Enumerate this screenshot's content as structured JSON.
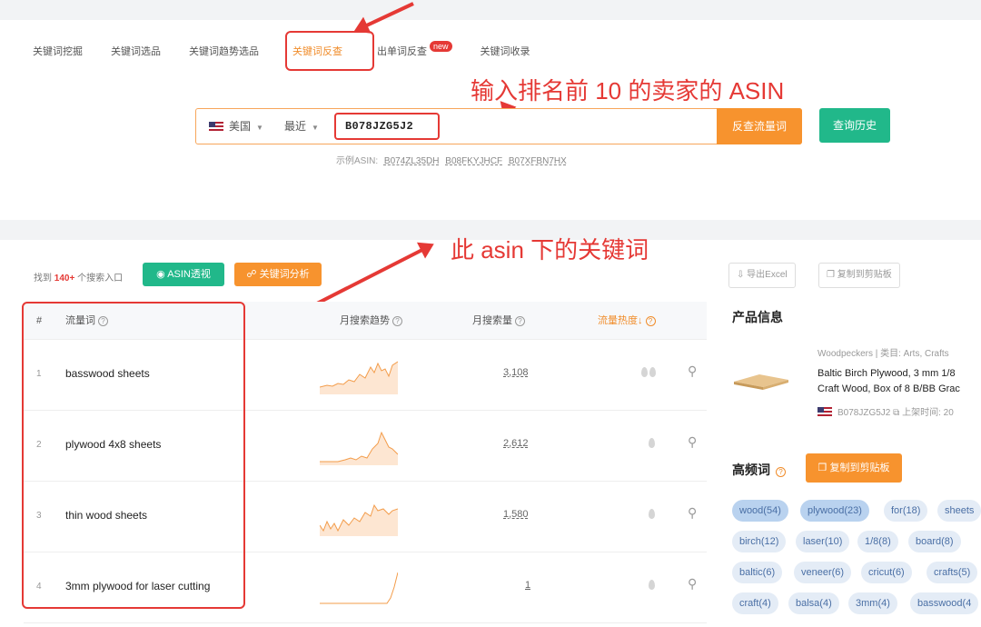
{
  "tabs": [
    {
      "label": "关键词挖掘"
    },
    {
      "label": "关键词选品"
    },
    {
      "label": "关键词趋势选品"
    },
    {
      "label": "关键词反查"
    },
    {
      "label": "出单词反查",
      "badge": "new"
    },
    {
      "label": "关键词收录"
    }
  ],
  "search": {
    "country": "美国",
    "period": "最近",
    "asin_value": "B078JZG5J2",
    "reverse_button": "反查流量词",
    "history_button": "查询历史",
    "examples_label": "示例ASIN:",
    "examples": [
      "B074ZL35DH",
      "B08FKYJHCF",
      "B07XFBN7HX"
    ]
  },
  "annotations": {
    "input_hint": "输入排名前 10 的卖家的 ASIN",
    "keywords_hint": "此 asin 下的关键词"
  },
  "results": {
    "found_prefix": "找到",
    "found_count": "140+",
    "found_suffix": "个搜索入口",
    "asin_button": "ASIN透视",
    "kw_button": "关键词分析"
  },
  "table": {
    "headers": {
      "idx": "#",
      "keyword": "流量词",
      "trend": "月搜索趋势",
      "volume": "月搜索量",
      "heat": "流量热度↓"
    },
    "rows": [
      {
        "idx": "1",
        "keyword": "basswood sheets",
        "volume": "3,108",
        "drops": 2
      },
      {
        "idx": "2",
        "keyword": "plywood 4x8 sheets",
        "volume": "2,612",
        "drops": 1
      },
      {
        "idx": "3",
        "keyword": "thin wood sheets",
        "volume": "1,580",
        "drops": 1
      },
      {
        "idx": "4",
        "keyword": "3mm plywood for laser cutting",
        "volume": "1",
        "drops": 1
      }
    ]
  },
  "side": {
    "export_button": "导出Excel",
    "copy_button": "复制到剪贴板",
    "product_title": "产品信息",
    "product_meta": "Woodpeckers | 类目: Arts, Crafts",
    "product_line1": "Baltic Birch Plywood, 3 mm 1/8",
    "product_line2": "Craft Wood, Box of 8 B/BB Grac",
    "product_asin": "B078JZG5J2",
    "product_date": "上架时间: 20",
    "freq_title": "高频词",
    "freq_copy_button": "复制到剪贴板",
    "tags": [
      {
        "label": "wood(54)",
        "strong": true
      },
      {
        "label": "plywood(23)",
        "strong": true
      },
      {
        "label": "for(18)",
        "strong": false
      },
      {
        "label": "sheets",
        "strong": false
      },
      {
        "label": "birch(12)",
        "strong": false
      },
      {
        "label": "laser(10)",
        "strong": false
      },
      {
        "label": "1/8(8)",
        "strong": false
      },
      {
        "label": "board(8)",
        "strong": false
      },
      {
        "label": "baltic(6)",
        "strong": false
      },
      {
        "label": "veneer(6)",
        "strong": false
      },
      {
        "label": "cricut(6)",
        "strong": false
      },
      {
        "label": "crafts(5)",
        "strong": false
      },
      {
        "label": "craft(4)",
        "strong": false
      },
      {
        "label": "balsa(4)",
        "strong": false
      },
      {
        "label": "3mm(4)",
        "strong": false
      },
      {
        "label": "basswood(4",
        "strong": false
      }
    ]
  },
  "colors": {
    "accent": "#f7932e",
    "green": "#21b88a",
    "annotation": "#e53935"
  }
}
